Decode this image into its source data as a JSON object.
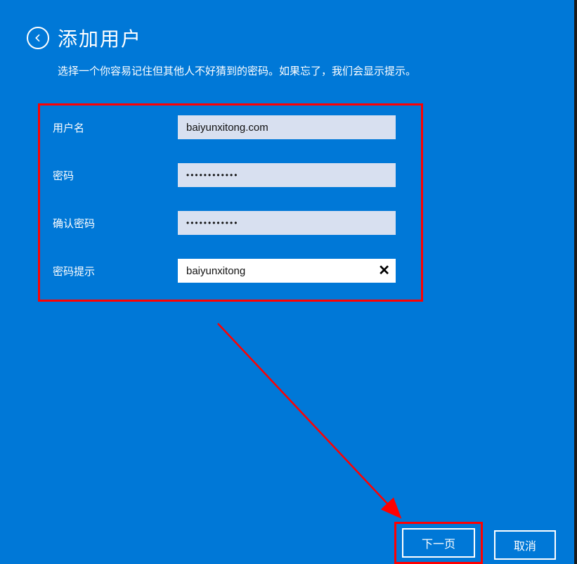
{
  "header": {
    "title": "添加用户",
    "subtitle": "选择一个你容易记住但其他人不好猜到的密码。如果忘了，我们会显示提示。"
  },
  "form": {
    "username": {
      "label": "用户名",
      "value": "baiyunxitong.com"
    },
    "password": {
      "label": "密码",
      "value": "••••••••••••"
    },
    "confirmPassword": {
      "label": "确认密码",
      "value": "••••••••••••"
    },
    "passwordHint": {
      "label": "密码提示",
      "value": "baiyunxitong"
    }
  },
  "buttons": {
    "next": "下一页",
    "cancel": "取消"
  }
}
